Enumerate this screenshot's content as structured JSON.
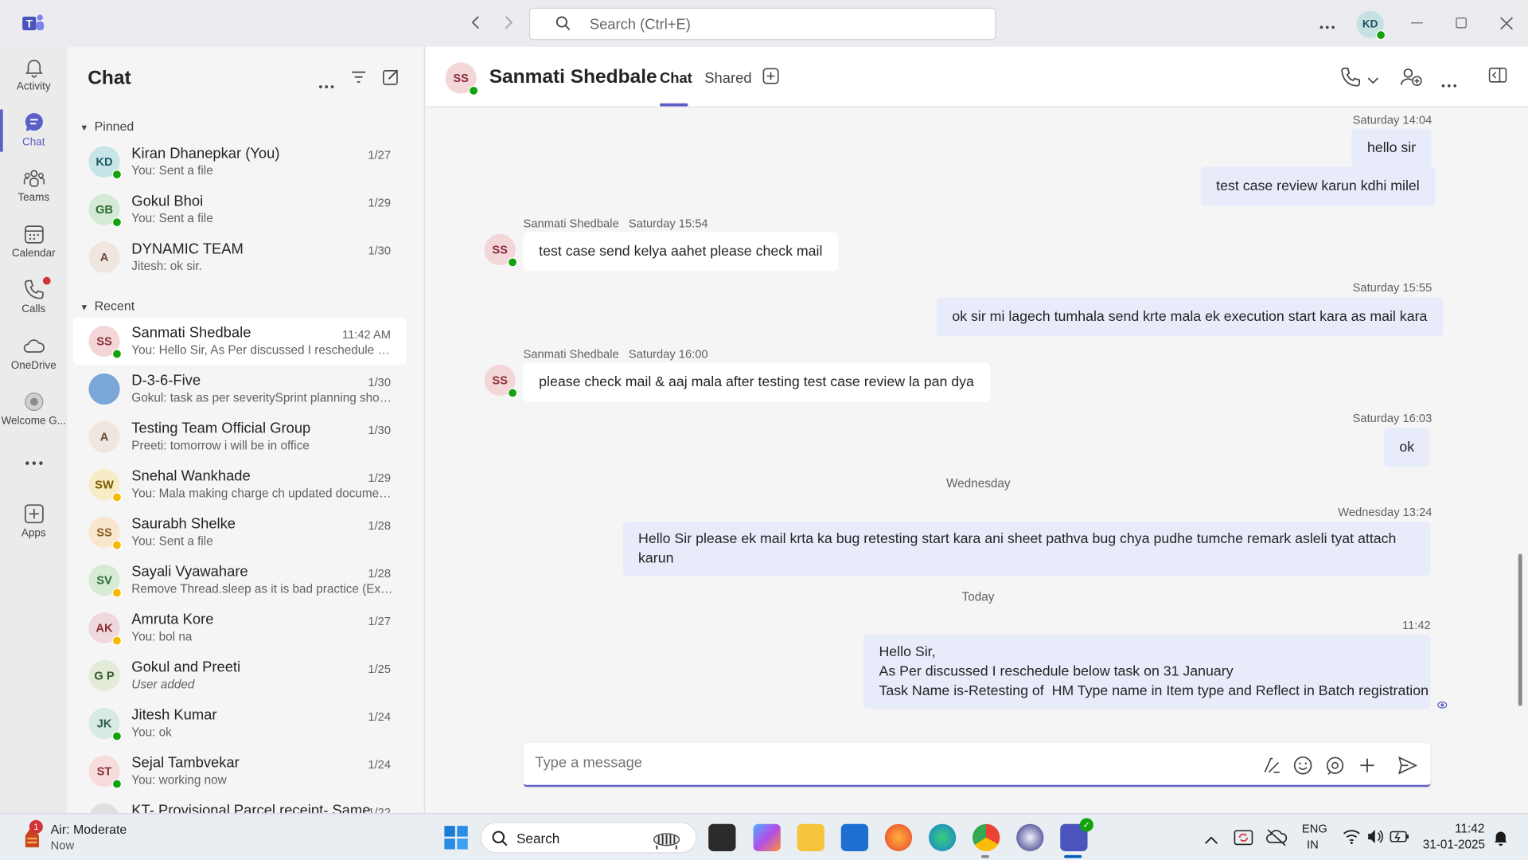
{
  "titlebar": {
    "search_placeholder": "Search (Ctrl+E)",
    "user_initials": "KD"
  },
  "rail": [
    {
      "label": "Activity",
      "icon": "bell-icon"
    },
    {
      "label": "Chat",
      "icon": "chat-icon",
      "active": true
    },
    {
      "label": "Teams",
      "icon": "teams-icon"
    },
    {
      "label": "Calendar",
      "icon": "calendar-icon"
    },
    {
      "label": "Calls",
      "icon": "phone-icon"
    },
    {
      "label": "OneDrive",
      "icon": "cloud-icon"
    },
    {
      "label": "Welcome G...",
      "icon": "welcome-icon"
    },
    {
      "label": "Apps",
      "icon": "apps-add-icon"
    }
  ],
  "chatlist": {
    "title": "Chat",
    "pinned_label": "Pinned",
    "recent_label": "Recent",
    "pinned": [
      {
        "initials": "KD",
        "name": "Kiran Dhanepkar (You)",
        "preview": "You: Sent a file",
        "date": "1/27",
        "avatar_bg": "#c7e4e8",
        "avatar_fg": "#1f5a63",
        "status": "available"
      },
      {
        "initials": "GB",
        "name": "Gokul Bhoi",
        "preview": "You: Sent a file",
        "date": "1/29",
        "avatar_bg": "#d4ead5",
        "avatar_fg": "#2e6b31",
        "status": "available"
      },
      {
        "initials": "A",
        "name": "DYNAMIC TEAM",
        "preview": "Jitesh: ok sir.",
        "date": "1/30",
        "avatar_bg": "#efe6e0",
        "avatar_fg": "#6b4a3a",
        "status": ""
      }
    ],
    "recent": [
      {
        "initials": "SS",
        "name": "Sanmati Shedbale",
        "preview": "You: Hello Sir, As Per discussed I reschedule bel...",
        "date": "11:42 AM",
        "avatar_bg": "#f3d6d8",
        "avatar_fg": "#8a2d36",
        "status": "available",
        "selected": true
      },
      {
        "initials": "",
        "name": "D-3-6-Five",
        "preview": "Gokul: task as per severitySprint planning shoul...",
        "date": "1/30",
        "avatar_bg": "#7aa6d8",
        "avatar_fg": "#ffffff",
        "status": ""
      },
      {
        "initials": "A",
        "name": "Testing Team Official Group",
        "preview": "Preeti: tomorrow i will be in office",
        "date": "1/30",
        "avatar_bg": "#efe6e0",
        "avatar_fg": "#6b4a3a",
        "status": ""
      },
      {
        "initials": "SW",
        "name": "Snehal Wankhade",
        "preview": "You: Mala making charge ch updated documen...",
        "date": "1/29",
        "avatar_bg": "#f6ecc6",
        "avatar_fg": "#7a5a00",
        "status": "away"
      },
      {
        "initials": "SS",
        "name": "Saurabh Shelke",
        "preview": "You: Sent a file",
        "date": "1/28",
        "avatar_bg": "#f8e6cf",
        "avatar_fg": "#8a5a1a",
        "status": "away"
      },
      {
        "initials": "SV",
        "name": "Sayali Vyawahare",
        "preview": "Remove Thread.sleep as it is bad practice (Expli...",
        "date": "1/28",
        "avatar_bg": "#d7ead3",
        "avatar_fg": "#2e6b31",
        "status": "away"
      },
      {
        "initials": "AK",
        "name": "Amruta Kore",
        "preview": "You: bol na",
        "date": "1/27",
        "avatar_bg": "#f0d9dd",
        "avatar_fg": "#8a2d36",
        "status": "away"
      },
      {
        "initials": "G P",
        "name": "Gokul and Preeti",
        "preview": "User added",
        "date": "1/25",
        "avatar_bg": "#e3ecd9",
        "avatar_fg": "#3c5a2a",
        "status": "",
        "italic": true
      },
      {
        "initials": "JK",
        "name": "Jitesh Kumar",
        "preview": "You: ok",
        "date": "1/24",
        "avatar_bg": "#d8ebe3",
        "avatar_fg": "#2b5e4a",
        "status": "available"
      },
      {
        "initials": "ST",
        "name": "Sejal Tambvekar",
        "preview": "You: working now",
        "date": "1/24",
        "avatar_bg": "#f6dcdc",
        "avatar_fg": "#8a2d36",
        "status": "available"
      },
      {
        "initials": "",
        "name": "KT- Provisional Parcel receipt- Same...",
        "preview": "",
        "date": "1/22",
        "avatar_bg": "#e0e0e0",
        "avatar_fg": "#333333",
        "status": ""
      }
    ]
  },
  "conversation": {
    "contact_name": "Sanmati Shedbale",
    "contact_initials": "SS",
    "tab_chat": "Chat",
    "tab_shared": "Shared",
    "messages": [
      {
        "dir": "out",
        "meta": "Saturday 14:04",
        "text": "hello sir"
      },
      {
        "dir": "out",
        "meta": "",
        "text": "test case review karun kdhi milel"
      },
      {
        "dir": "in",
        "sender": "Sanmati Shedbale",
        "meta": "Saturday 15:54",
        "text": "test case send kelya aahet please check mail"
      },
      {
        "dir": "out",
        "meta": "Saturday 15:55",
        "text": "ok sir mi lagech tumhala send krte mala ek execution start kara as mail kara"
      },
      {
        "dir": "in",
        "sender": "Sanmati Shedbale",
        "meta": "Saturday 16:00",
        "text": "please check mail & aaj mala after testing test case review la pan dya"
      },
      {
        "dir": "out",
        "meta": "Saturday 16:03",
        "text": "ok"
      },
      {
        "dir": "day",
        "text": "Wednesday"
      },
      {
        "dir": "out",
        "meta": "Wednesday 13:24",
        "text": "Hello Sir please ek mail krta ka bug retesting start kara ani sheet pathva bug chya pudhe tumche remark asleli tyat attach karun"
      },
      {
        "dir": "day",
        "text": "Today"
      },
      {
        "dir": "out",
        "meta": "11:42",
        "lines": [
          "Hello Sir,",
          "As Per discussed I reschedule below task on 31 January",
          "Task Name is-Retesting of  HM Type name in Item type and Reflect in Batch registration"
        ]
      }
    ],
    "composer_placeholder": "Type a message"
  },
  "taskbar": {
    "weather_title": "Air: Moderate",
    "weather_sub": "Now",
    "weather_badge": "1",
    "search_label": "Search",
    "lang_top": "ENG",
    "lang_bottom": "IN",
    "time": "11:42",
    "date": "31-01-2025"
  }
}
